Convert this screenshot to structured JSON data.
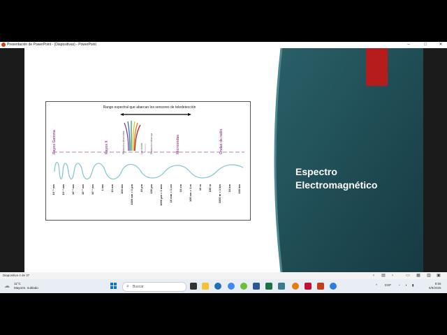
{
  "window": {
    "title": "Presentación de PowerPoint - (Diapositivas) - PowerPoint",
    "controls": [
      "–",
      "□",
      "✕"
    ]
  },
  "slide": {
    "title_line1": "Espectro",
    "title_line2": "Electromagnético",
    "panel_color": "#1e4a52",
    "accent_color": "#b71c1c"
  },
  "figure": {
    "header": "Rango espectral que abarcan los sensores de teledetección",
    "band_labels": [
      "Rayos Gamma",
      "Rayos X",
      "Radiación ultravioleta",
      "Luz visible",
      "Radiación infrarroja",
      "Microondas",
      "Ondas de radio"
    ],
    "scale_labels": [
      "10⁻⁵ nm",
      "10⁻⁴ nm",
      "10⁻³ nm",
      "10⁻² nm",
      "10⁻¹ nm",
      "1 nm",
      "10 nm",
      "100 nm",
      "1000 nm = 1 µm",
      "10 µm",
      "100 µm",
      "1000 µm = 1 mm",
      "10 mm = 1 cm",
      "10 cm",
      "100 cm = 1 m",
      "10 m",
      "100 m",
      "1000 m = 1 km",
      "10 km",
      "100 km"
    ]
  },
  "statusbar": {
    "slide_count": "Diapositiva 4 de 37"
  },
  "taskbar": {
    "temperature": "11°C",
    "condition": "Mayorm. nublado",
    "search_placeholder": "Buscar",
    "language": "ESP",
    "time": "8:56",
    "date": "5/9/2025"
  }
}
